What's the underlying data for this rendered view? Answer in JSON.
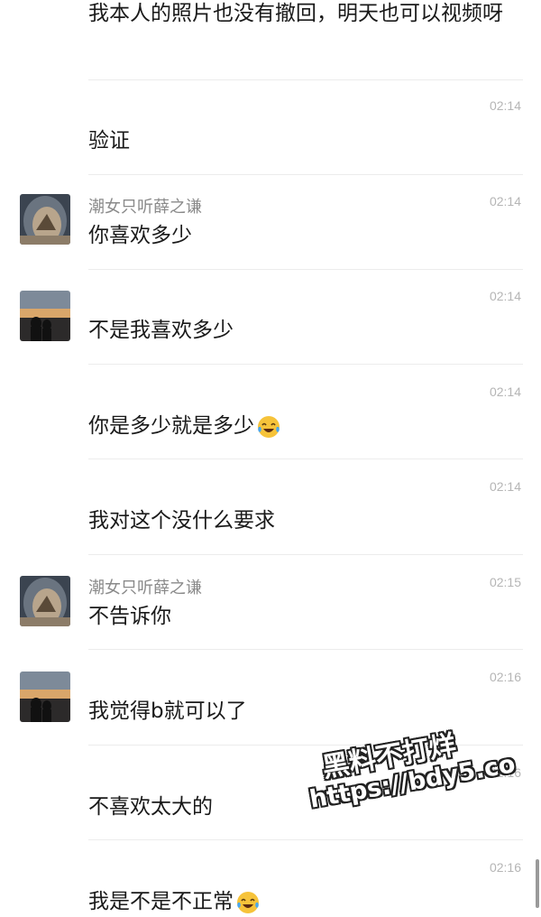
{
  "messages": [
    {
      "text": "我本人的照片也没有撤回，明天也可以视频呀",
      "time": "",
      "name": "",
      "avatar": "none"
    },
    {
      "text": "验证",
      "time": "02:14",
      "name": "",
      "avatar": "none"
    },
    {
      "text": "你喜欢多少",
      "time": "02:14",
      "name": "潮女只听薛之谦",
      "avatar": "girl"
    },
    {
      "text": "不是我喜欢多少",
      "time": "02:14",
      "name": "",
      "avatar": "sunset"
    },
    {
      "text": "你是多少就是多少",
      "time": "02:14",
      "name": "",
      "avatar": "none",
      "emoji": "laugh-cry-emoji"
    },
    {
      "text": "我对这个没什么要求",
      "time": "02:14",
      "name": "",
      "avatar": "none"
    },
    {
      "text": "不告诉你",
      "time": "02:15",
      "name": "潮女只听薛之谦",
      "avatar": "girl"
    },
    {
      "text": "我觉得b就可以了",
      "time": "02:16",
      "name": "",
      "avatar": "sunset"
    },
    {
      "text": "不喜欢太大的",
      "time": "02:16",
      "name": "",
      "avatar": "none"
    },
    {
      "text": "我是不是不正常",
      "time": "02:16",
      "name": "",
      "avatar": "none",
      "emoji": "laugh-cry-emoji"
    }
  ],
  "watermark": {
    "line1": "黑料不打烊",
    "line2": "https://bdy5.co"
  },
  "colors": {
    "text": "#1a1a1a",
    "name": "#8a8a8a",
    "time": "#b5b5b5",
    "separator": "#ececec"
  }
}
